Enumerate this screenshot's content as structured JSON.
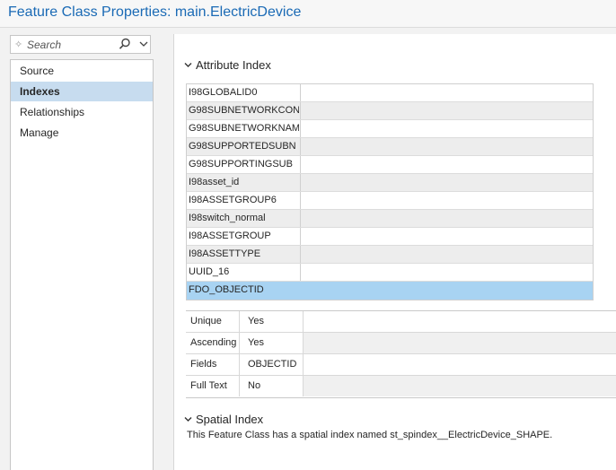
{
  "window": {
    "title": "Feature Class Properties: main.ElectricDevice"
  },
  "search": {
    "placeholder": "Search",
    "search_icon": "magnifier-icon",
    "dropdown_icon": "chevron-down-icon",
    "sparkle_icon": "sparkle-icon"
  },
  "sidebar": {
    "items": [
      {
        "label": "Source"
      },
      {
        "label": "Indexes",
        "selected": true
      },
      {
        "label": "Relationships"
      },
      {
        "label": "Manage"
      }
    ]
  },
  "attribute_index": {
    "heading": "Attribute Index",
    "indexes": [
      "I98GLOBALID0",
      "G98SUBNETWORKCON",
      "G98SUBNETWORKNAM",
      "G98SUPPORTEDSUBN",
      "G98SUPPORTINGSUB",
      "I98asset_id",
      "I98ASSETGROUP6",
      "I98switch_normal",
      "I98ASSETGROUP",
      "I98ASSETTYPE",
      "UUID_16",
      "FDO_OBJECTID"
    ],
    "selected_index": "FDO_OBJECTID",
    "properties": [
      {
        "label": "Unique",
        "value": "Yes"
      },
      {
        "label": "Ascending",
        "value": "Yes"
      },
      {
        "label": "Fields",
        "value": "OBJECTID"
      },
      {
        "label": "Full Text",
        "value": "No"
      }
    ]
  },
  "spatial_index": {
    "heading": "Spatial Index",
    "description": "This Feature Class has a spatial index named st_spindex__ElectricDevice_SHAPE."
  },
  "colors": {
    "title": "#1a6ab5",
    "selected_nav": "#c7dcef",
    "selected_row": "#a8d3f2"
  }
}
